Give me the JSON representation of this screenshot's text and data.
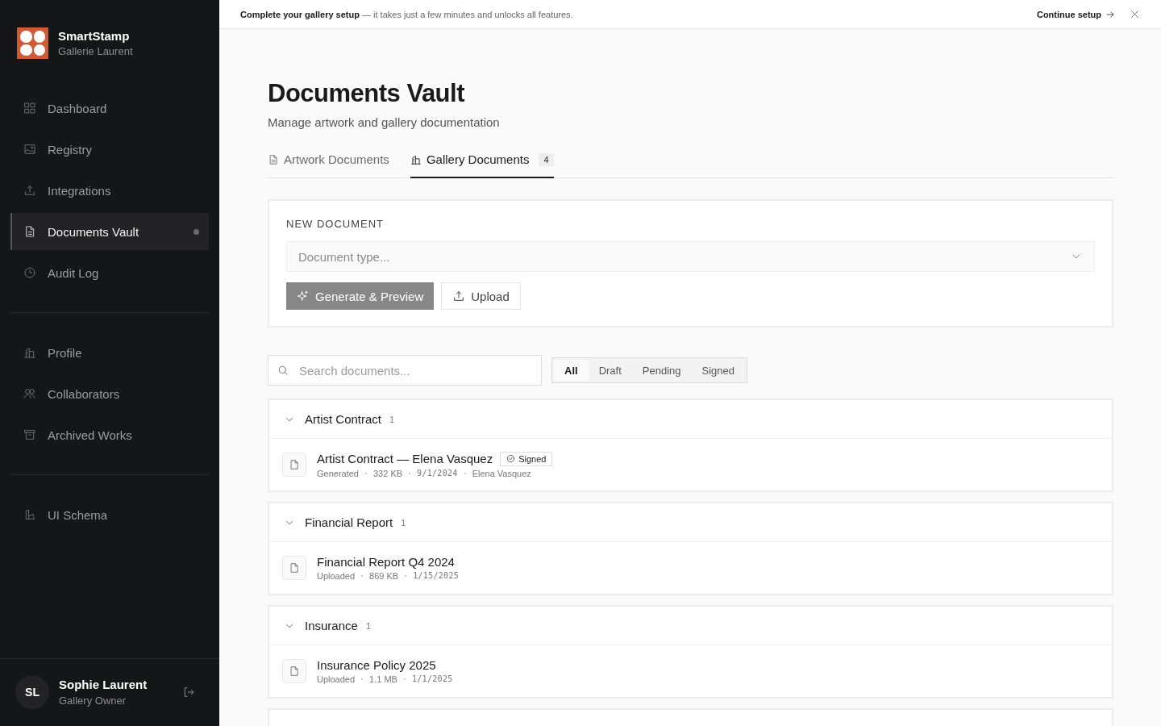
{
  "sidebar": {
    "brand": {
      "name": "SmartStamp",
      "subtitle": "Gallerie Laurent"
    },
    "sections": [
      {
        "items": [
          {
            "label": "Dashboard",
            "selected": false,
            "dot": false
          },
          {
            "label": "Registry",
            "selected": false,
            "dot": false
          },
          {
            "label": "Integrations",
            "selected": false,
            "dot": false
          },
          {
            "label": "Documents Vault",
            "selected": true,
            "dot": true
          },
          {
            "label": "Audit Log",
            "selected": false,
            "dot": false
          }
        ]
      },
      {
        "items": [
          {
            "label": "Profile",
            "selected": false,
            "dot": false
          },
          {
            "label": "Collaborators",
            "selected": false,
            "dot": false
          },
          {
            "label": "Archived Works",
            "selected": false,
            "dot": false
          }
        ]
      },
      {
        "items": [
          {
            "label": "UI Schema",
            "selected": false,
            "dot": false
          }
        ]
      }
    ],
    "user": {
      "initials": "SL",
      "name": "Sophie Laurent",
      "role": "Gallery Owner"
    }
  },
  "banner": {
    "text": "**Complete your gallery setup** — it takes just a few minutes and unlocks all features.",
    "action": "Continue setup"
  },
  "page": {
    "title": "Documents Vault",
    "subtitle": "Manage artwork and gallery documentation"
  },
  "tabs": [
    {
      "label": "Artwork Documents",
      "selected": false
    },
    {
      "label": "Gallery Documents",
      "selected": true,
      "count": "4"
    }
  ],
  "new_document": {
    "heading": "NEW DOCUMENT",
    "placeholder": "Document type...",
    "buttons": [
      {
        "label": "Generate & Preview",
        "kind": "primary",
        "disabled": true
      },
      {
        "label": "Upload",
        "kind": "secondary",
        "disabled": false
      }
    ]
  },
  "search": {
    "placeholder": "Search documents..."
  },
  "filters": [
    {
      "label": "All",
      "selected": true
    },
    {
      "label": "Draft",
      "selected": false
    },
    {
      "label": "Pending",
      "selected": false
    },
    {
      "label": "Signed",
      "selected": false
    }
  ],
  "groups": [
    {
      "title": "Artist Contract",
      "count": "1",
      "expanded": true,
      "documents": [
        {
          "title": "Artist Contract — Elena Vasquez",
          "status": "Signed",
          "meta": [
            "Generated",
            "332 KB",
            "9/1/2024",
            "Elena Vasquez"
          ]
        }
      ]
    },
    {
      "title": "Financial Report",
      "count": "1",
      "expanded": true,
      "documents": [
        {
          "title": "Financial Report Q4 2024",
          "meta": [
            "Uploaded",
            "869 KB",
            "1/15/2025"
          ]
        }
      ]
    },
    {
      "title": "Insurance",
      "count": "1",
      "expanded": true,
      "documents": [
        {
          "title": "Insurance Policy 2025",
          "meta": [
            "Uploaded",
            "1.1 MB",
            "1/1/2025"
          ]
        }
      ]
    }
  ]
}
